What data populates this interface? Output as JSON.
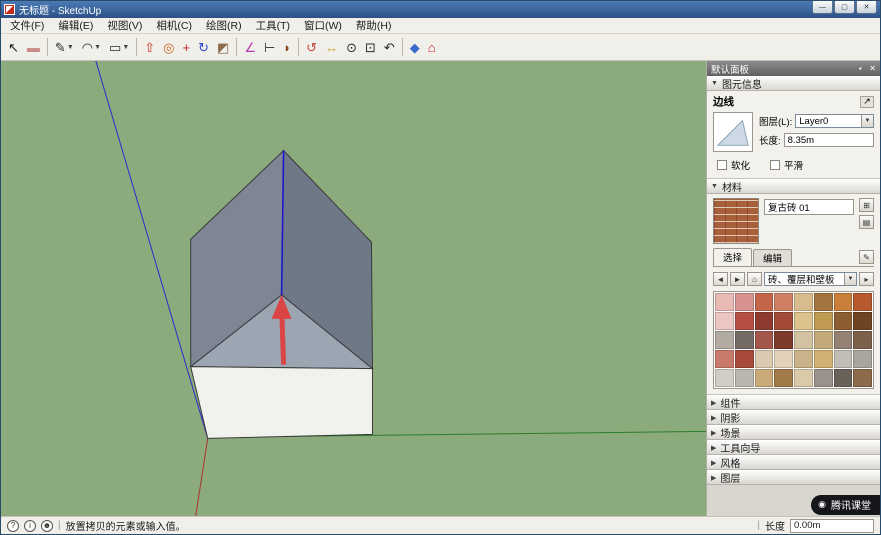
{
  "window": {
    "title": "无标题 - SketchUp"
  },
  "icons": {
    "minimize": "—",
    "maximize": "▢",
    "close": "✕",
    "pin": "▪",
    "dropdown": "▼",
    "expanded": "▼",
    "collapsed": "▶",
    "detach": "↗",
    "back": "◄",
    "forward": "►",
    "home": "⌂",
    "create_material": "⊞",
    "secondary_pane": "▤",
    "sample_paint": "✎",
    "details": "▸",
    "separator": "|",
    "help": "?",
    "info": "i",
    "user": "☻",
    "penguin": "◉"
  },
  "menu": {
    "items": [
      "文件(F)",
      "编辑(E)",
      "视图(V)",
      "相机(C)",
      "绘图(R)",
      "工具(T)",
      "窗口(W)",
      "帮助(H)"
    ]
  },
  "toolbar": {
    "tools": [
      {
        "id": "select",
        "glyph": "↖",
        "color": "#1a1a1a"
      },
      {
        "id": "eraser",
        "glyph": "▬",
        "color": "#c98a8a"
      },
      {
        "id": "line",
        "glyph": "✎",
        "color": "#2a2a2a",
        "dropdown": true,
        "sep": true
      },
      {
        "id": "arc",
        "glyph": "◠",
        "color": "#2a2a2a",
        "dropdown": true
      },
      {
        "id": "rectangle",
        "glyph": "▭",
        "color": "#2a2a2a",
        "dropdown": true
      },
      {
        "id": "push-pull",
        "glyph": "⇧",
        "color": "#cc3322",
        "sep": true
      },
      {
        "id": "offset",
        "glyph": "◎",
        "color": "#cc6622"
      },
      {
        "id": "move",
        "glyph": "+",
        "color": "#cc2222"
      },
      {
        "id": "rotate",
        "glyph": "↻",
        "color": "#2a4acc"
      },
      {
        "id": "scale",
        "glyph": "◩",
        "color": "#8a6a4a"
      },
      {
        "id": "tape-measure",
        "glyph": "∠",
        "color": "#b03ab0",
        "sep": true
      },
      {
        "id": "dimension",
        "glyph": "⊢",
        "color": "#2a2a2a"
      },
      {
        "id": "paint-bucket",
        "glyph": "◗",
        "color": "#8a4a22"
      },
      {
        "id": "orbit",
        "glyph": "↺",
        "color": "#cc4444",
        "sep": true
      },
      {
        "id": "pan",
        "glyph": "↔",
        "color": "#c8a83a"
      },
      {
        "id": "zoom",
        "glyph": "⊙",
        "color": "#2a2a2a"
      },
      {
        "id": "zoom-extents",
        "glyph": "⊡",
        "color": "#2a2a2a"
      },
      {
        "id": "previous-view",
        "glyph": "↶",
        "color": "#2a2a2a"
      },
      {
        "id": "model-info",
        "glyph": "◆",
        "color": "#3a6acc",
        "sep": true
      },
      {
        "id": "get-models",
        "glyph": "⌂",
        "color": "#cc2222"
      }
    ]
  },
  "panel": {
    "title": "默认面板",
    "entity_info": {
      "header": "图元信息",
      "type": "边线",
      "layer_label": "图层(L):",
      "layer_value": "Layer0",
      "length_label": "长度:",
      "length_value": "8.35m",
      "soften": "软化",
      "smooth": "平滑"
    },
    "materials": {
      "header": "材料",
      "current_name": "复古砖 01",
      "tab_select": "选择",
      "tab_edit": "编辑",
      "category": "砖、覆层和壁板",
      "swatches": [
        "#e9b9b4",
        "#d89090",
        "#c2654a",
        "#cf7f63",
        "#d9bc8e",
        "#a4743f",
        "#c87f3a",
        "#b65a2e",
        "#ecc6c2",
        "#b84f44",
        "#8e3a30",
        "#a34b37",
        "#dcc38d",
        "#c09a50",
        "#8e5e33",
        "#6e4423",
        "#b3aaa2",
        "#746c64",
        "#a3564a",
        "#7e3b2b",
        "#d2c2a2",
        "#c2aa7a",
        "#938274",
        "#7c614a",
        "#ca7a6a",
        "#a84a3a",
        "#dbcab2",
        "#e2d2ba",
        "#cab28a",
        "#d2b272",
        "#c2beb6",
        "#aaa69e",
        "#d2cec6",
        "#bab6ae",
        "#caaa7a",
        "#a27a4a",
        "#dacaaa",
        "#9a928a",
        "#6a6258",
        "#8c6a4a"
      ]
    },
    "collapsed_sections": [
      "组件",
      "阴影",
      "场景",
      "工具向导",
      "风格",
      "图层"
    ]
  },
  "statusbar": {
    "message": "放置拷贝的元素或输入值。",
    "length_label": "长度",
    "length_value": "0.00m"
  },
  "overlay": {
    "badge_text": "腾讯课堂"
  },
  "colors": {
    "viewport_bg": "#8cab7c",
    "roof_left": "#7e8695",
    "roof_right": "#6f7887",
    "gable": "#9ba6b2",
    "wall": "#f1f1ee",
    "axis_blue": "#2a2acc",
    "axis_green": "#2d7d2d",
    "axis_red": "#aa3333",
    "arrow_red": "#e23b3b",
    "selected_edge": "#1a1acc"
  }
}
